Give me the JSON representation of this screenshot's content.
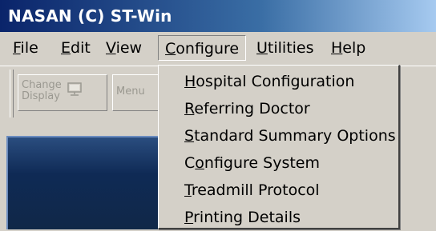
{
  "window": {
    "title": "NASAN (C) ST-Win"
  },
  "menubar": {
    "items": [
      {
        "pre": "",
        "u": "F",
        "post": "ile"
      },
      {
        "pre": "",
        "u": "E",
        "post": "dit"
      },
      {
        "pre": "",
        "u": "V",
        "post": "iew"
      },
      {
        "pre": "",
        "u": "C",
        "post": "onfigure"
      },
      {
        "pre": "",
        "u": "U",
        "post": "tilities"
      },
      {
        "pre": "",
        "u": "H",
        "post": "elp"
      }
    ],
    "active_index": 3
  },
  "toolbar": {
    "change_display_line1": "Change",
    "change_display_line2": "Display",
    "menu_partial": "Menu"
  },
  "configure_menu": {
    "items": [
      {
        "pre": "",
        "u": "H",
        "post": "ospital Configuration"
      },
      {
        "pre": "",
        "u": "R",
        "post": "eferring Doctor"
      },
      {
        "pre": "",
        "u": "S",
        "post": "tandard Summary Options"
      },
      {
        "pre": "C",
        "u": "o",
        "post": "nfigure System"
      },
      {
        "pre": "",
        "u": "T",
        "post": "readmill Protocol"
      },
      {
        "pre": "",
        "u": "P",
        "post": "rinting Details"
      }
    ]
  },
  "colors": {
    "titlebar_start": "#0a246a",
    "titlebar_end": "#a6caf0",
    "face": "#d4d0c8"
  }
}
